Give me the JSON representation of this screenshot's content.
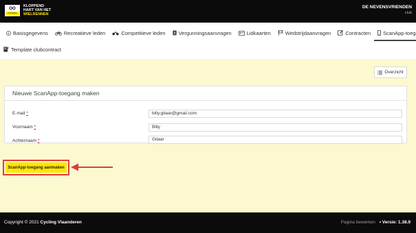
{
  "header": {
    "logo_badge": "OO",
    "logo_badge_sub": "CYCLING VLAANDEREN",
    "logo_line1": "KLOPPEND",
    "logo_line2": "HART VAN HET",
    "logo_line3": "WIELRENNEN",
    "club_name": "DE NEVENSVRIENDEN",
    "club_sub": "club"
  },
  "tabs": [
    {
      "label": "Basisgegevens",
      "icon": "info-icon"
    },
    {
      "label": "Recreatieve leden",
      "icon": "bicycle-icon"
    },
    {
      "label": "Competitieve leden",
      "icon": "motorbike-icon"
    },
    {
      "label": "Vergunningsaanvragen",
      "icon": "id-badge-icon"
    },
    {
      "label": "Lidkaarten",
      "icon": "card-icon"
    },
    {
      "label": "Wedstrijdaanvragen",
      "icon": "flag-icon"
    },
    {
      "label": "Contracten",
      "icon": "contract-icon"
    },
    {
      "label": "ScanApp-toegangen",
      "icon": "phone-icon",
      "active": true
    },
    {
      "label": "Template clubcontract",
      "icon": "document-icon"
    }
  ],
  "overview_button": "Overzicht",
  "form": {
    "title": "Nieuwe ScanApp-toegang maken",
    "fields": [
      {
        "label": "E-mail",
        "req": "*",
        "value": "billy.gitaar@gmail.com"
      },
      {
        "label": "Voornaam",
        "req": "*",
        "value": "Billy"
      },
      {
        "label": "Achternaam",
        "req": "*",
        "value": "Gitaar"
      }
    ],
    "submit_label": "ScanApp-toegang aanmaken"
  },
  "footer": {
    "copyright": "Copyright © 2021",
    "brand": "Cycling Vlaanderen",
    "edit_label": "Pagina bewerken",
    "version_label": "• Versie: 1.38.9"
  },
  "colors": {
    "accent_yellow": "#ffe600",
    "content_bg": "#fcf8cf",
    "highlight_red": "#e23b3b"
  }
}
